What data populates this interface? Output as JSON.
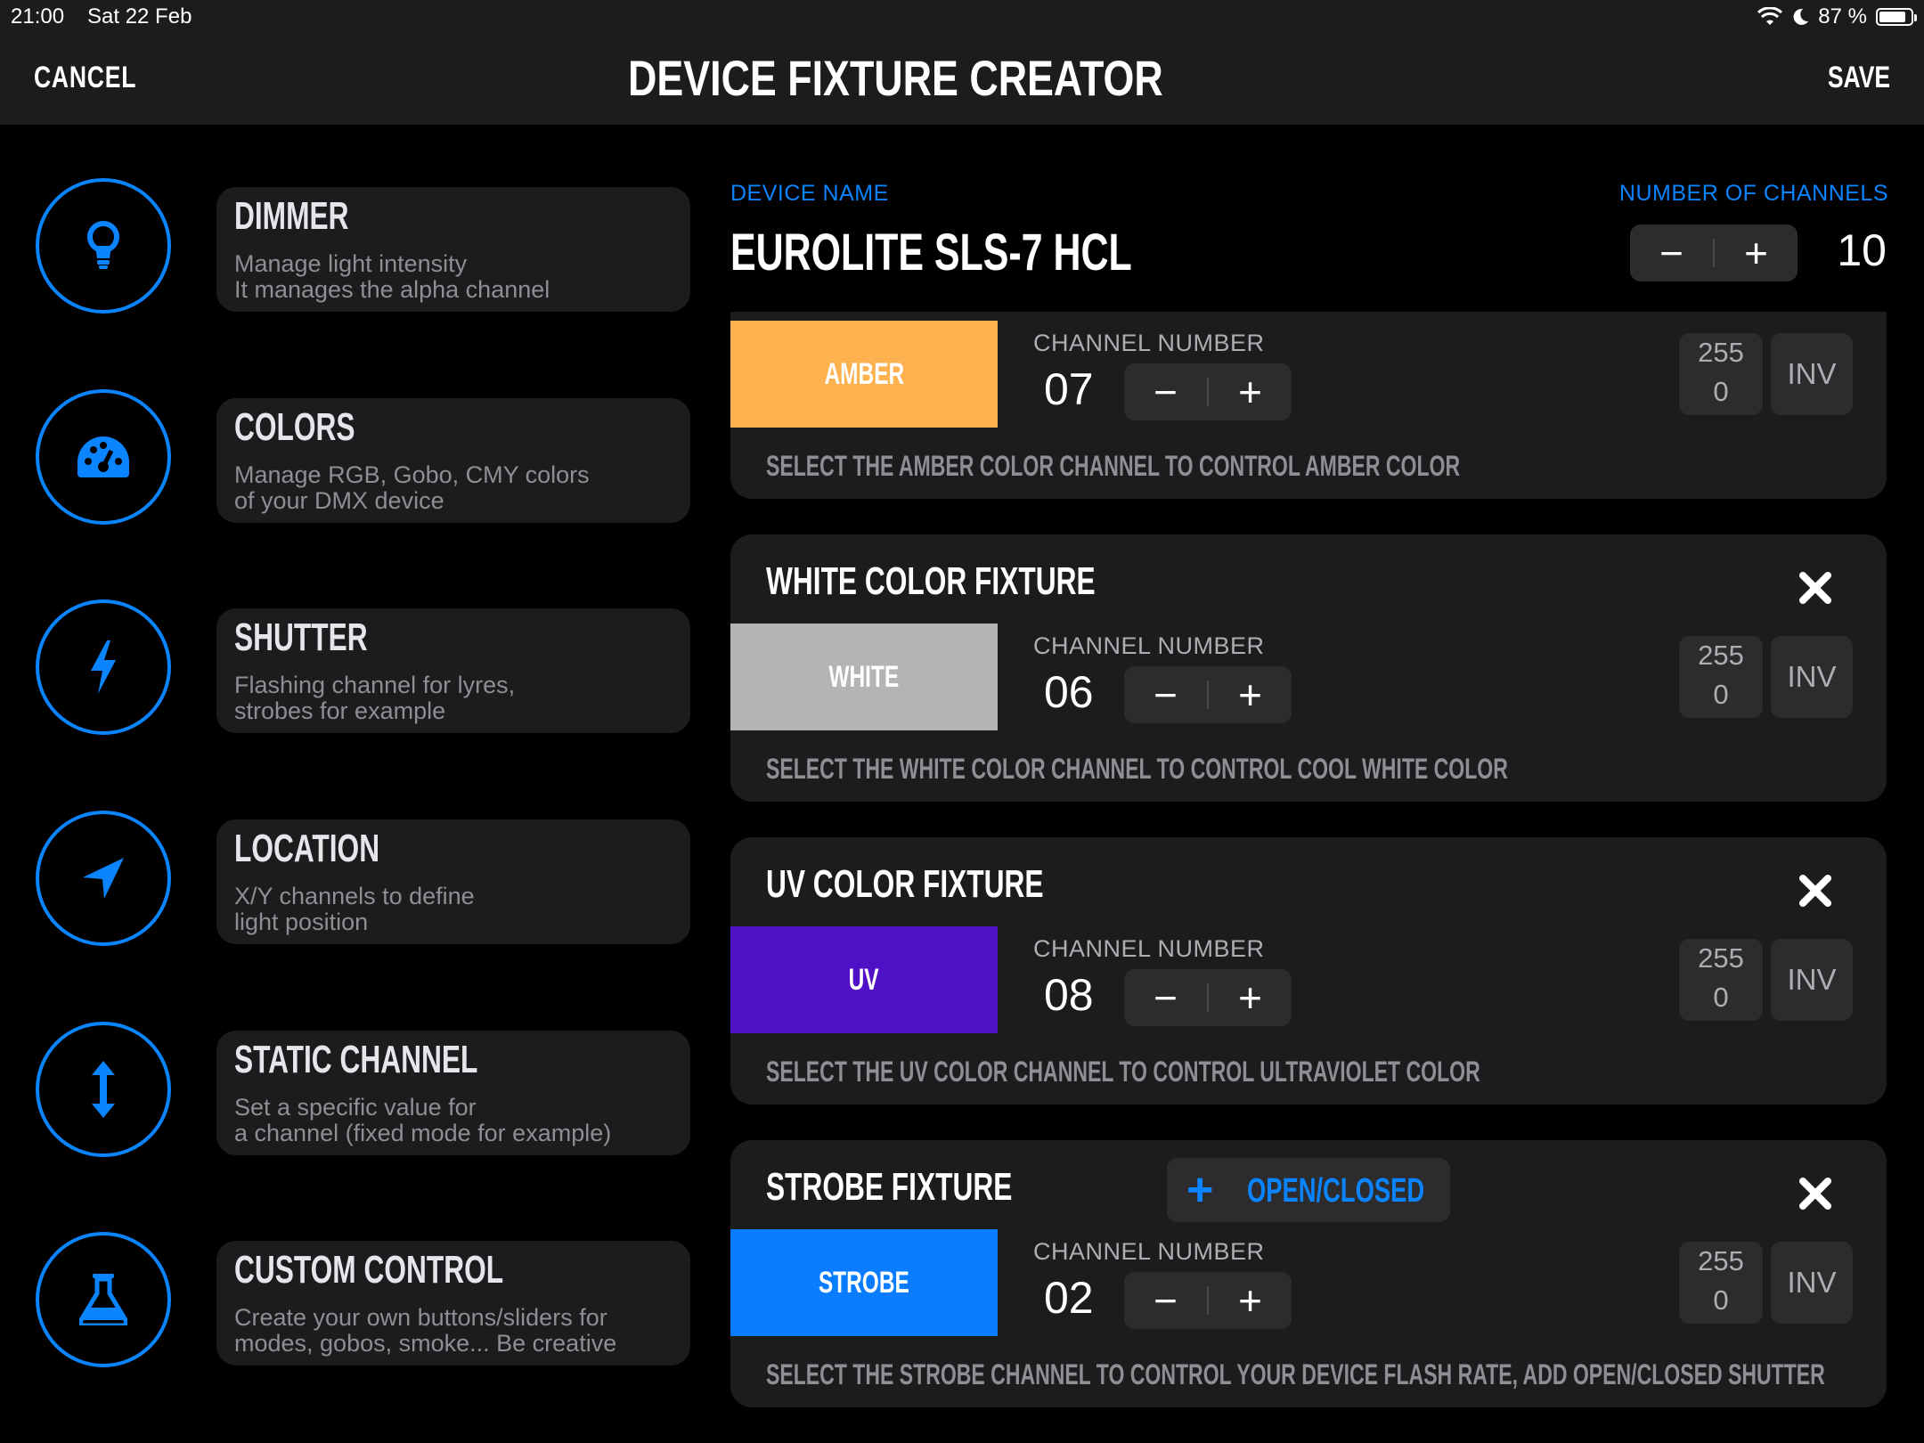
{
  "status_bar": {
    "time": "21:00",
    "date": "Sat 22 Feb",
    "battery": "87 %"
  },
  "header": {
    "cancel": "CANCEL",
    "title": "DEVICE FIXTURE CREATOR",
    "save": "SAVE"
  },
  "sidebar": {
    "items": [
      {
        "title": "DIMMER",
        "line1": "Manage light intensity",
        "line2": "It manages the alpha channel",
        "icon": "lightbulb-icon"
      },
      {
        "title": "COLORS",
        "line1": "Manage RGB, Gobo, CMY colors",
        "line2": "of your DMX device",
        "icon": "palette-icon"
      },
      {
        "title": "SHUTTER",
        "line1": "Flashing channel for lyres,",
        "line2": "strobes for example",
        "icon": "bolt-icon"
      },
      {
        "title": "LOCATION",
        "line1": "X/Y channels to define",
        "line2": "light position",
        "icon": "location-arrow-icon"
      },
      {
        "title": "STATIC CHANNEL",
        "line1": "Set a specific value for",
        "line2": "a channel (fixed mode for example)",
        "icon": "vertical-arrows-icon"
      },
      {
        "title": "CUSTOM CONTROL",
        "line1": "Create your own buttons/sliders for",
        "line2": "modes, gobos, smoke... Be creative",
        "icon": "flask-icon"
      }
    ]
  },
  "device": {
    "name_label": "DEVICE NAME",
    "name": "EUROLITE SLS-7 HCL",
    "channels_label": "NUMBER OF CHANNELS",
    "channels": "10",
    "minus": "−",
    "plus": "+"
  },
  "fixtures": [
    {
      "title": "",
      "swatch_label": "AMBER",
      "swatch_color": "#feb14f",
      "swatch_text_color": "#ffffff",
      "channel_label": "CHANNEL NUMBER",
      "channel": "07",
      "range_max": "255",
      "range_min": "0",
      "inv": "INV",
      "description": "SELECT THE AMBER COLOR CHANNEL TO CONTROL AMBER COLOR"
    },
    {
      "title": "WHITE COLOR FIXTURE",
      "swatch_label": "WHITE",
      "swatch_color": "#b4b4b4",
      "swatch_text_color": "#ffffff",
      "channel_label": "CHANNEL NUMBER",
      "channel": "06",
      "range_max": "255",
      "range_min": "0",
      "inv": "INV",
      "description": "SELECT THE WHITE COLOR CHANNEL TO CONTROL COOL WHITE COLOR"
    },
    {
      "title": "UV COLOR FIXTURE",
      "swatch_label": "UV",
      "swatch_color": "#5011c6",
      "swatch_text_color": "#ffffff",
      "channel_label": "CHANNEL NUMBER",
      "channel": "08",
      "range_max": "255",
      "range_min": "0",
      "inv": "INV",
      "description": "SELECT THE UV COLOR CHANNEL TO CONTROL ULTRAVIOLET COLOR"
    },
    {
      "title": "STROBE FIXTURE",
      "swatch_label": "STROBE",
      "swatch_color": "#0a7cff",
      "swatch_text_color": "#ffffff",
      "channel_label": "CHANNEL NUMBER",
      "channel": "02",
      "range_max": "255",
      "range_min": "0",
      "inv": "INV",
      "description": "SELECT THE STROBE CHANNEL TO CONTROL YOUR DEVICE FLASH RATE, ADD OPEN/CLOSED SHUTTER",
      "extra_button": "OPEN/CLOSED"
    }
  ],
  "accent_color": "#0a84ff"
}
